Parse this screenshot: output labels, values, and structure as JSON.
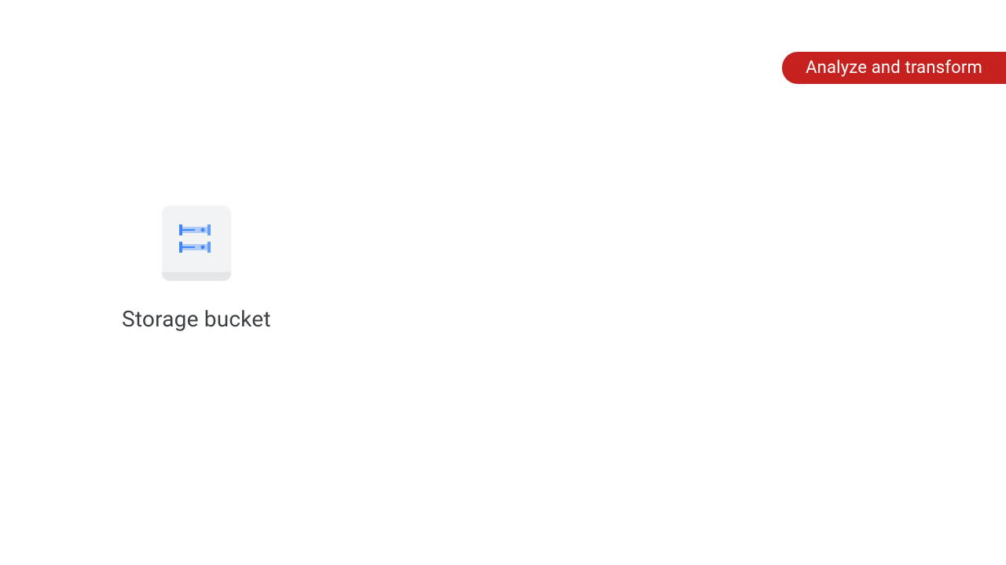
{
  "badge": {
    "label": "Analyze and transform",
    "color": "#c5221f"
  },
  "resource": {
    "label": "Storage bucket",
    "icon_name": "storage-servers"
  }
}
